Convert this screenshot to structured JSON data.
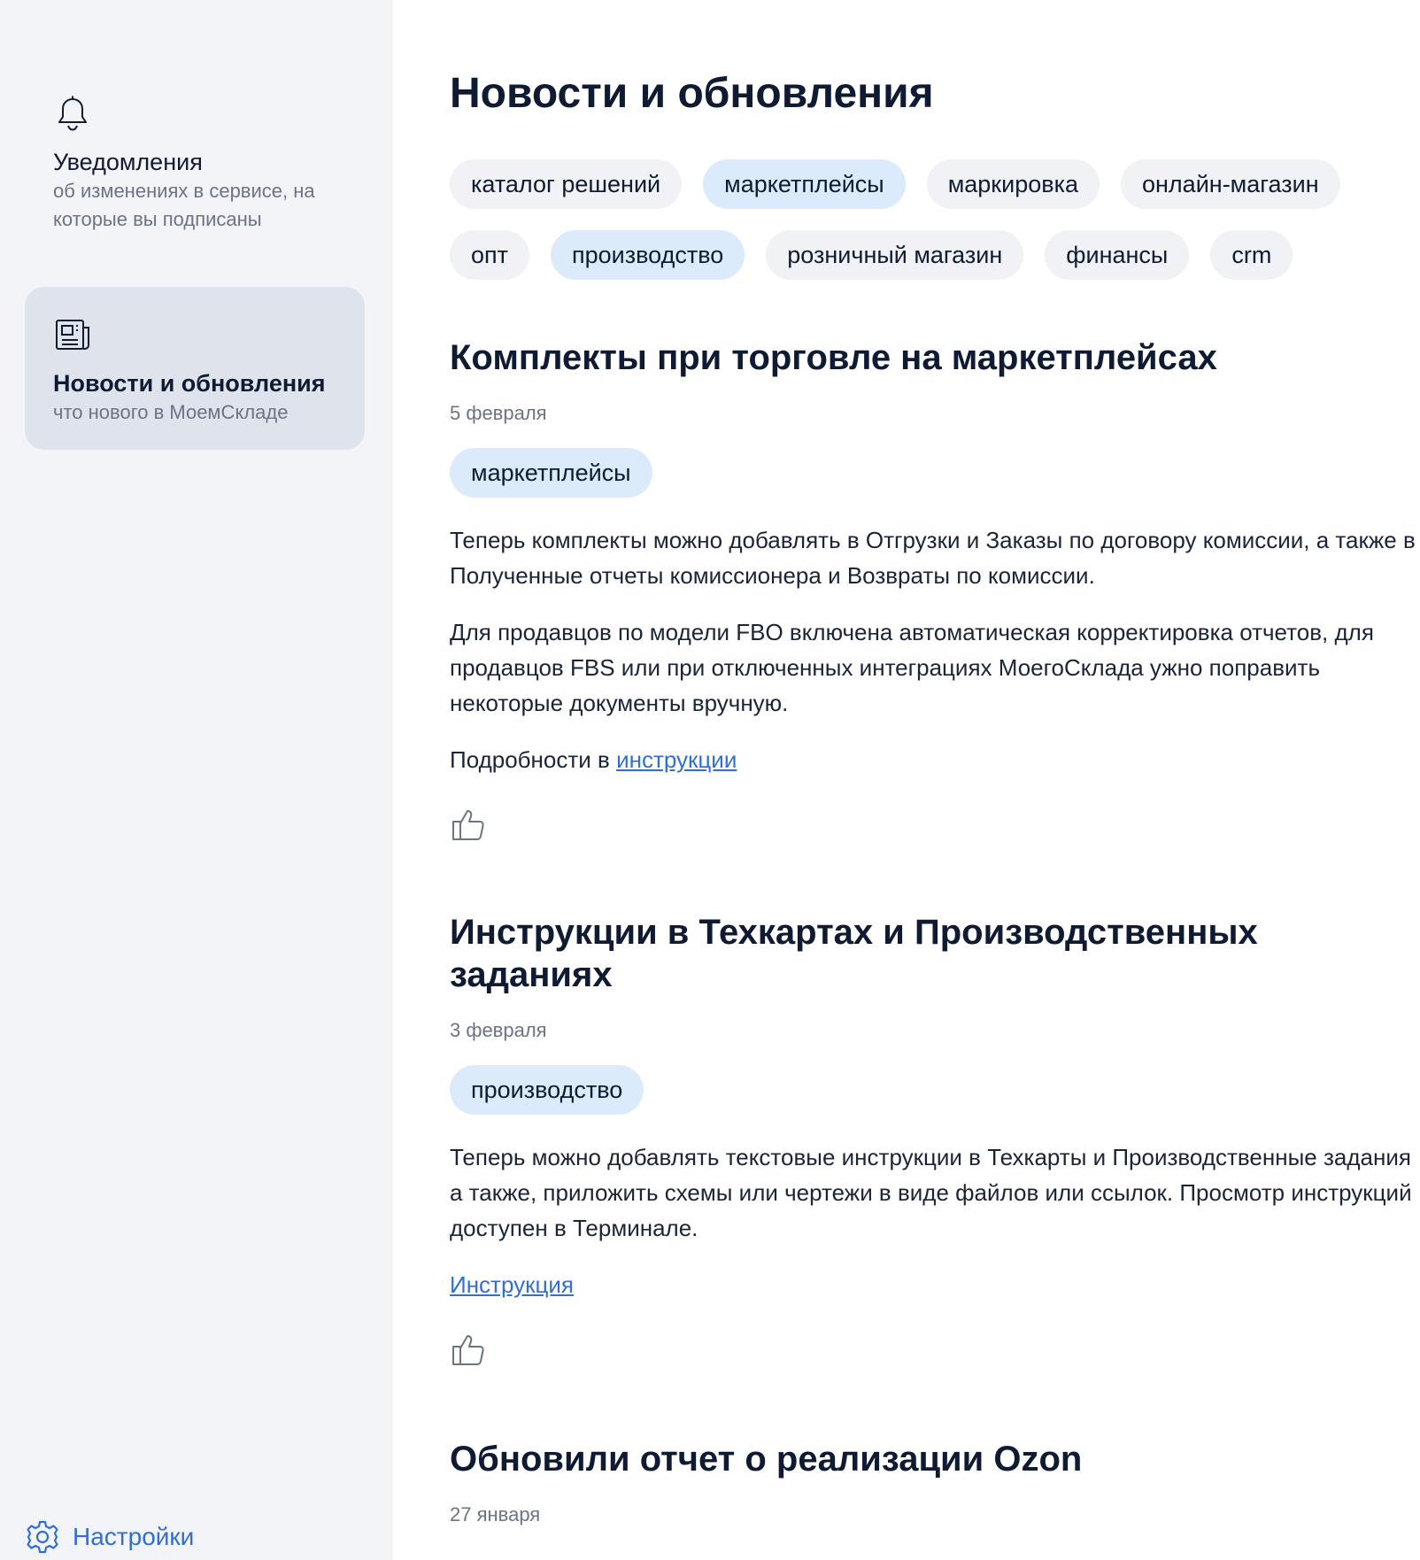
{
  "sidebar": {
    "items": [
      {
        "title": "Уведомления",
        "subtitle": "об изменениях в сервисе, на которые вы подписаны",
        "icon": "bell-icon",
        "active": false
      },
      {
        "title": "Новости и обновления",
        "subtitle": "что нового в МоемСкладе",
        "icon": "newspaper-icon",
        "active": true
      }
    ],
    "settings_label": "Настройки"
  },
  "main": {
    "title": "Новости и обновления",
    "filters": [
      {
        "label": "каталог решений",
        "selected": false
      },
      {
        "label": "маркетплейсы",
        "selected": true
      },
      {
        "label": "маркировка",
        "selected": false
      },
      {
        "label": "онлайн-магазин",
        "selected": false
      },
      {
        "label": "опт",
        "selected": false
      },
      {
        "label": "производство",
        "selected": true
      },
      {
        "label": "розничный магазин",
        "selected": false
      },
      {
        "label": "финансы",
        "selected": false
      },
      {
        "label": "crm",
        "selected": false
      }
    ],
    "articles": [
      {
        "title": "Комплекты при торговле на маркетплейсах",
        "date": "5 февраля",
        "tag": "маркетплейсы",
        "p1": "Теперь комплекты можно добавлять в Отгрузки и Заказы по договору комиссии, а также в Полученные отчеты комиссионера и Возвраты по комиссии.",
        "p2": "Для продавцов по модели FBO включена автоматическая корректировка отчетов, для продавцов FBS или при отключенных интеграциях МоегоСклада ужно поправить некоторые документы вручную.",
        "more_prefix": "Подробности в ",
        "more_link": "инструкции"
      },
      {
        "title": "Инструкции в Техкартах и Производственных заданиях",
        "date": "3 февраля",
        "tag": "производство",
        "p1": "Теперь можно добавлять текстовые инструкции в Техкарты и Производственные задания а также, приложить схемы или чертежи в виде файлов или ссылок. Просмотр инструкций доступен в Терминале.",
        "link": "Инструкция"
      },
      {
        "title": "Обновили отчет о реализации Ozon",
        "date": "27 января"
      }
    ]
  },
  "colors": {
    "accent": "#2f6fd6",
    "sidebar_bg": "#f2f4f7",
    "active_item_bg": "#dfe4ec",
    "chip_bg": "#f0f2f6",
    "chip_selected_bg": "#dcebfb",
    "text": "#0f1a33",
    "muted": "#6b7484"
  }
}
